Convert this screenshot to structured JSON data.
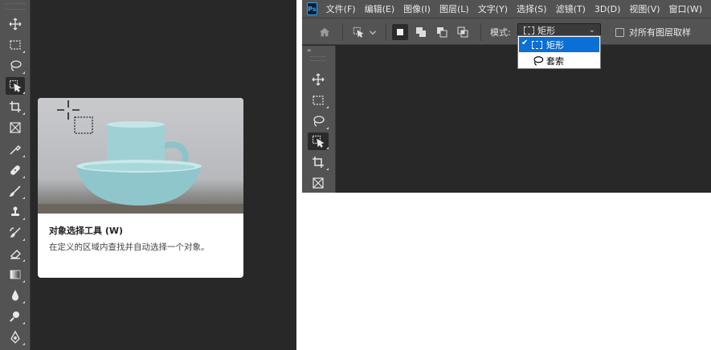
{
  "left_panel": {
    "tools": [
      {
        "name": "move-icon"
      },
      {
        "name": "marquee-icon"
      },
      {
        "name": "lasso-icon"
      },
      {
        "name": "object-selection-icon",
        "active": true
      },
      {
        "name": "crop-icon"
      },
      {
        "name": "frame-icon"
      },
      {
        "name": "eyedropper-icon"
      },
      {
        "name": "healing-brush-icon"
      },
      {
        "name": "brush-icon"
      },
      {
        "name": "clone-stamp-icon"
      },
      {
        "name": "history-brush-icon"
      },
      {
        "name": "eraser-icon"
      },
      {
        "name": "gradient-icon"
      },
      {
        "name": "blur-icon"
      },
      {
        "name": "dodge-icon"
      },
      {
        "name": "pen-icon"
      }
    ],
    "tooltip": {
      "title": "对象选择工具 (W)",
      "description": "在定义的区域内查找并自动选择一个对象。"
    }
  },
  "right_panel": {
    "app_logo": "Ps",
    "menu": [
      "文件(F)",
      "编辑(E)",
      "图像(I)",
      "图层(L)",
      "文字(Y)",
      "选择(S)",
      "滤镜(T)",
      "3D(D)",
      "视图(V)",
      "窗口(W)"
    ],
    "options_bar": {
      "mode_label": "模式:",
      "mode_value": "矩形",
      "sample_all_layers_label": "对所有图层取样",
      "sample_all_layers_checked": false
    },
    "mode_dropdown": {
      "options": [
        {
          "label": "矩形",
          "icon": "rectangle-marquee-icon",
          "selected": true
        },
        {
          "label": "套索",
          "icon": "lasso-icon",
          "selected": false
        }
      ]
    },
    "side_tools": [
      {
        "name": "move-icon"
      },
      {
        "name": "marquee-icon"
      },
      {
        "name": "lasso-icon"
      },
      {
        "name": "object-selection-icon",
        "active": true
      },
      {
        "name": "crop-icon"
      },
      {
        "name": "frame-icon"
      }
    ],
    "colors": {
      "ui_panel": "#535353",
      "canvas_bg": "#282828",
      "selection_blue": "#0a6fd6",
      "ps_blue": "#31a8ff"
    }
  }
}
